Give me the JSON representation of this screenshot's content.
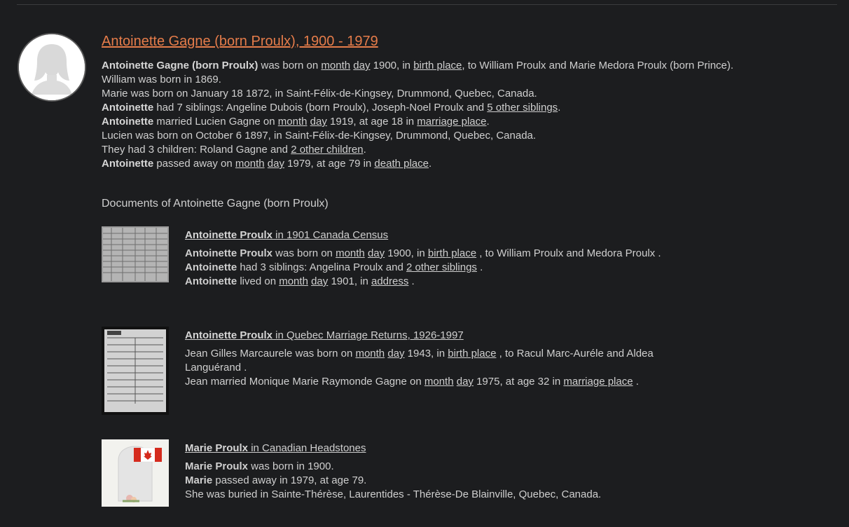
{
  "person": {
    "title": "Antoinette Gagne (born Proulx), 1900 - 1979",
    "bio": {
      "l1_name": "Antoinette Gagne (born Proulx)",
      "l1_a": " was born on ",
      "month": "month",
      "day": "day",
      "l1_b": " 1900, in ",
      "birth_place": "birth place",
      "l1_c": ", to William Proulx and Marie Medora Proulx (born Prince).",
      "l2": "William was born in 1869.",
      "l3": "Marie was born on January 18 1872, in Saint-Félix-de-Kingsey, Drummond, Quebec, Canada.",
      "first_name": "Antoinette",
      "l4_a": " had 7 siblings: Angeline Dubois (born Proulx), Joseph-Noel Proulx and ",
      "l4_link": "5 other siblings",
      "l4_b": ".",
      "l5_a": " married Lucien Gagne on ",
      "l5_b": " 1919, at age 18 in ",
      "marriage_place": "marriage place",
      "l5_c": ".",
      "l6": "Lucien was born on October 6 1897, in Saint-Félix-de-Kingsey, Drummond, Quebec, Canada.",
      "l7_a": "They had 3 children: Roland Gagne and ",
      "l7_link": "2 other children",
      "l7_b": ".",
      "l8_a": " passed away on ",
      "l8_b": " 1979, at age 79 in ",
      "death_place": "death place",
      "l8_c": "."
    }
  },
  "documents": {
    "heading": "Documents of Antoinette Gagne (born Proulx)",
    "doc1": {
      "name": "Antoinette Proulx",
      "collection": " in 1901 Canada Census",
      "name_b": "Antoinette Proulx",
      "l1_a": " was born on ",
      "month": "month",
      "day": "day",
      "l1_b": " 1900, in ",
      "birth_place": "birth place",
      "l1_c": " , to William Proulx and Medora Proulx .",
      "first": "Antoinette",
      "l2_a": " had 3 siblings: Angelina Proulx and ",
      "l2_link": "2 other siblings",
      "l2_b": " .",
      "l3_a": " lived on ",
      "l3_b": " 1901, in ",
      "address": "address",
      "l3_c": " ."
    },
    "doc2": {
      "name": "Antoinette Proulx",
      "collection": " in Quebec Marriage Returns, 1926-1997",
      "l1_a": "Jean Gilles Marcaurele was born on ",
      "month": "month",
      "day": "day",
      "l1_b": " 1943, in ",
      "birth_place": "birth place",
      "l1_c": " , to Racul Marc-Auréle and Aldea Languérand .",
      "l2_a": "Jean married Monique Marie Raymonde Gagne on ",
      "l2_b": " 1975, at age 32 in ",
      "marriage_place": "marriage place",
      "l2_c": " ."
    },
    "doc3": {
      "name": "Marie Proulx",
      "collection": " in Canadian Headstones",
      "name_b": "Marie Proulx",
      "l1": " was born in 1900.",
      "first": "Marie",
      "l2": " passed away in 1979, at age 79.",
      "l3": "She was buried in Sainte-Thérèse, Laurentides - Thérèse-De Blainville, Quebec, Canada."
    }
  },
  "colors": {
    "background": "#1c1d1f",
    "title_accent": "#e57c4a",
    "text": "#cfcfcf"
  }
}
